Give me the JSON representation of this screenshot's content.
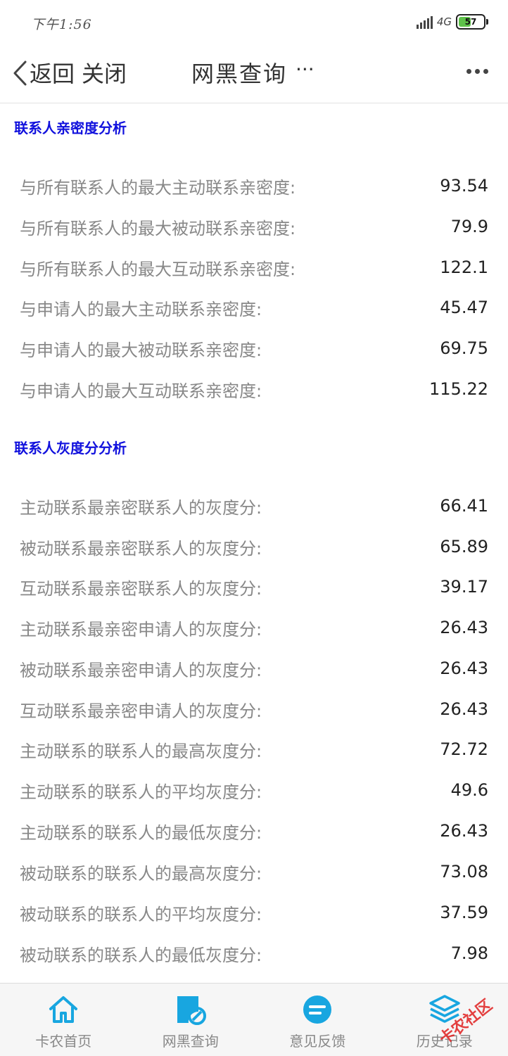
{
  "status_bar": {
    "time": "下午1:56",
    "network": "4G",
    "battery": "57",
    "battery_level": 0.57
  },
  "nav": {
    "back_label": "返回",
    "close_label": "关闭",
    "title": "网黑查询",
    "title_more": "···"
  },
  "sections": [
    {
      "title": "联系人亲密度分析",
      "rows": [
        {
          "label": "与所有联系人的最大主动联系亲密度:",
          "value": "93.54"
        },
        {
          "label": "与所有联系人的最大被动联系亲密度:",
          "value": "79.9"
        },
        {
          "label": "与所有联系人的最大互动联系亲密度:",
          "value": "122.1"
        },
        {
          "label": "与申请人的最大主动联系亲密度:",
          "value": "45.47"
        },
        {
          "label": "与申请人的最大被动联系亲密度:",
          "value": "69.75"
        },
        {
          "label": "与申请人的最大互动联系亲密度:",
          "value": "115.22"
        }
      ]
    },
    {
      "title": "联系人灰度分分析",
      "rows": [
        {
          "label": "主动联系最亲密联系人的灰度分:",
          "value": "66.41"
        },
        {
          "label": "被动联系最亲密联系人的灰度分:",
          "value": "65.89"
        },
        {
          "label": "互动联系最亲密联系人的灰度分:",
          "value": "39.17"
        },
        {
          "label": "主动联系最亲密申请人的灰度分:",
          "value": "26.43"
        },
        {
          "label": "被动联系最亲密申请人的灰度分:",
          "value": "26.43"
        },
        {
          "label": "互动联系最亲密申请人的灰度分:",
          "value": "26.43"
        },
        {
          "label": "主动联系的联系人的最高灰度分:",
          "value": "72.72"
        },
        {
          "label": "主动联系的联系人的平均灰度分:",
          "value": "49.6"
        },
        {
          "label": "主动联系的联系人的最低灰度分:",
          "value": "26.43"
        },
        {
          "label": "被动联系的联系人的最高灰度分:",
          "value": "73.08"
        },
        {
          "label": "被动联系的联系人的平均灰度分:",
          "value": "37.59"
        },
        {
          "label": "被动联系的联系人的最低灰度分:",
          "value": "7.98"
        }
      ]
    }
  ],
  "tabs": [
    {
      "label": "卡农首页",
      "icon": "home-icon"
    },
    {
      "label": "网黑查询",
      "icon": "query-icon"
    },
    {
      "label": "意见反馈",
      "icon": "feedback-icon"
    },
    {
      "label": "历史记录",
      "icon": "layers-icon"
    }
  ],
  "watermark": "卡农社区",
  "colors": {
    "accent": "#18a6e0",
    "section_title": "#1111dd",
    "label": "#888888",
    "value": "#222222"
  }
}
